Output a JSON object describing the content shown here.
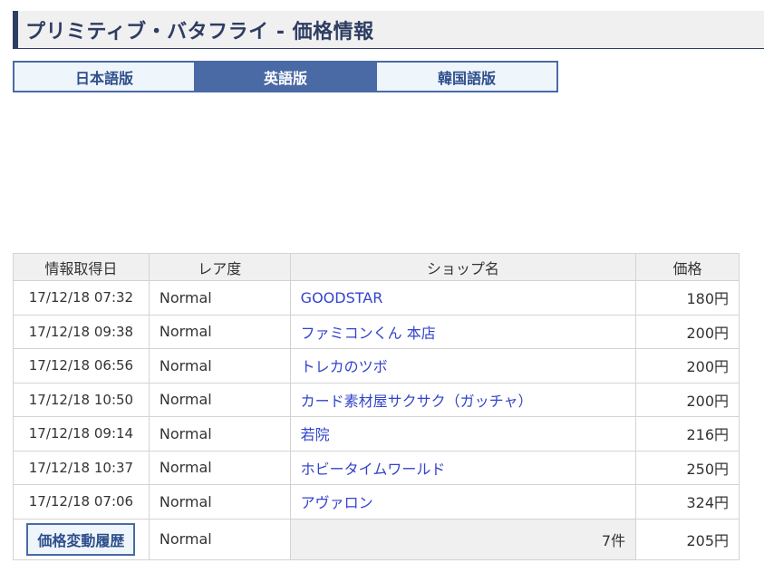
{
  "page": {
    "title": "プリミティブ・バタフライ - 価格情報"
  },
  "tabs": [
    {
      "label": "日本語版",
      "active": false
    },
    {
      "label": "英語版",
      "active": true
    },
    {
      "label": "韓国語版",
      "active": false
    }
  ],
  "table": {
    "headers": [
      "情報取得日",
      "レア度",
      "ショップ名",
      "価格"
    ],
    "rows": [
      {
        "date": "17/12/18 07:32",
        "rarity": "Normal",
        "shop": "GOODSTAR",
        "price": "180円"
      },
      {
        "date": "17/12/18 09:38",
        "rarity": "Normal",
        "shop": "ファミコンくん 本店",
        "price": "200円"
      },
      {
        "date": "17/12/18 06:56",
        "rarity": "Normal",
        "shop": "トレカのツボ",
        "price": "200円"
      },
      {
        "date": "17/12/18 10:50",
        "rarity": "Normal",
        "shop": "カード素材屋サクサク（ガッチャ）",
        "price": "200円"
      },
      {
        "date": "17/12/18 09:14",
        "rarity": "Normal",
        "shop": "若院",
        "price": "216円"
      },
      {
        "date": "17/12/18 10:37",
        "rarity": "Normal",
        "shop": "ホビータイムワールド",
        "price": "250円"
      },
      {
        "date": "17/12/18 07:06",
        "rarity": "Normal",
        "shop": "アヴァロン",
        "price": "324円"
      }
    ],
    "summary": {
      "button_label": "価格変動履歴",
      "rarity": "Normal",
      "count": "7件",
      "price": "205円"
    }
  },
  "colors": {
    "accent": "#4a6aa5",
    "title_text": "#2e3d63",
    "link": "#3344cc",
    "header_bg": "#f0f0f0"
  }
}
